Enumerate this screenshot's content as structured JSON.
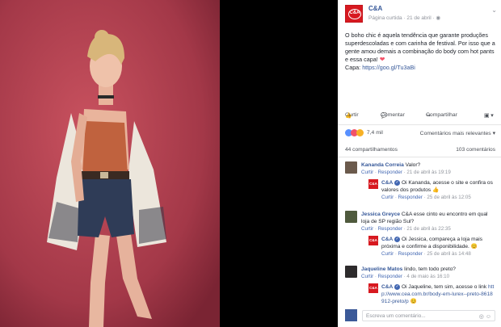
{
  "post": {
    "page_name": "C&A",
    "logo_text": "C&A",
    "meta": "Página curtida · 21 de abril · ",
    "globe_icon": "globe-icon",
    "text": "O boho chic é aquela tendência que garante produções superdescoladas e com carinha de festival. Por isso que a gente amou demais a combinação do body com hot pants e essa capa!",
    "capa_label": "Capa: ",
    "capa_link": "https://goo.gl/Tu3aBi"
  },
  "actions": {
    "like": "Curtir",
    "comment": "Comentar",
    "share": "Compartilhar"
  },
  "reactions": {
    "count": "7,4 mil",
    "sort": "Comentários mais relevantes ▾",
    "shares": "44 compartilhamentos",
    "comments": "103 comentários"
  },
  "comments": [
    {
      "name": "Kananda Correia",
      "text": " Valor?",
      "meta": "· 21 de abril às 19:19",
      "reply": {
        "name": "C&A",
        "text": " Oi Kananda, acesse o site e confira os valores dos produtos 👍",
        "meta": "· 25 de abril às 12:05"
      }
    },
    {
      "name": "Jessica Greyce",
      "text": " C&A esse cinto eu encontro em qual loja de SP região Sul?",
      "meta": "· 21 de abril às 22:35",
      "reply": {
        "name": "C&A",
        "text": " Oi Jessica, compareça a loja mais próxima e confirme a disponibilidade. 😊",
        "meta": "· 25 de abril às 14:48"
      }
    },
    {
      "name": "Jaqueline Matos",
      "text": " lindo, tem todo preto?",
      "meta": "· 4 de maio às 16:10",
      "reply": {
        "name": "C&A",
        "text": " Oi Jaqueline, tem sim, acesse o link ",
        "link": "http://www.cea.com.br/body-em-lurex--preto-8618912-preto/p",
        "emoji": " 😊"
      }
    }
  ],
  "comment_actions": {
    "like": "Curtir",
    "reply": "Responder"
  },
  "write": {
    "placeholder": "Escreva um comentário..."
  },
  "colors": {
    "brand": "#d71920",
    "link": "#365899",
    "backdrop": "#c24a5c"
  }
}
